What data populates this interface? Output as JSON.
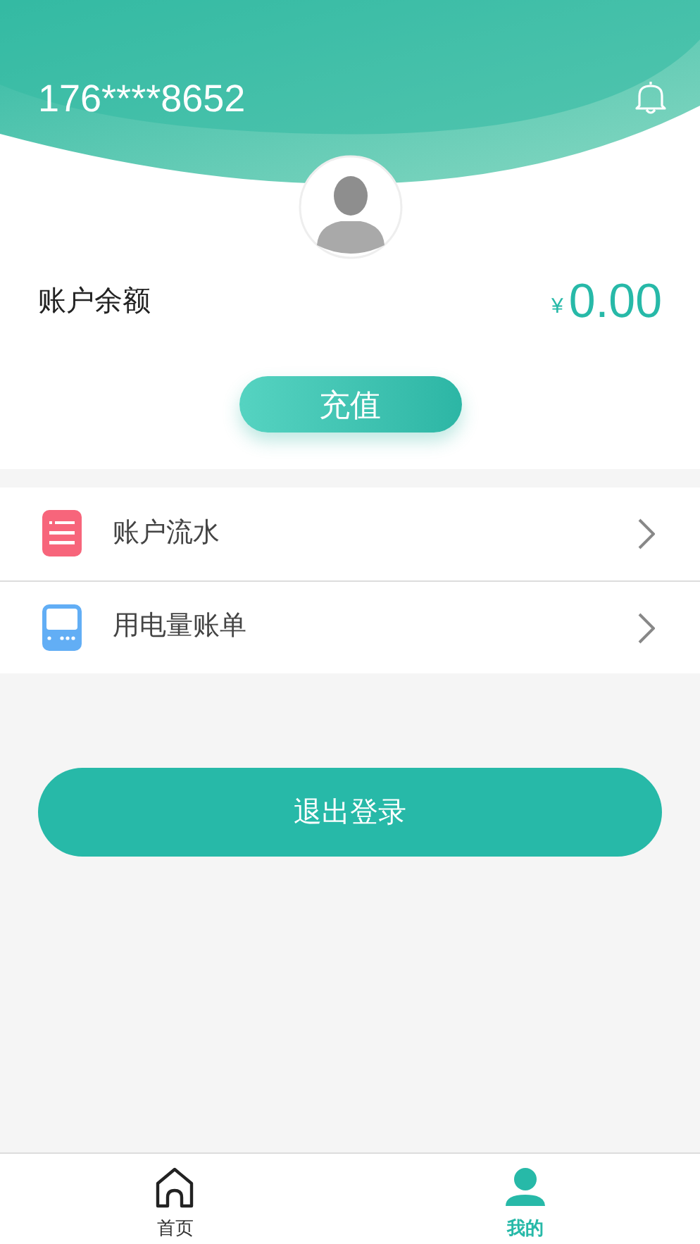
{
  "header": {
    "phone": "176****8652"
  },
  "balance": {
    "label": "账户余额",
    "currency": "¥",
    "amount": "0.00"
  },
  "recharge_button": "充值",
  "menu": [
    {
      "kind": "list",
      "label": "账户流水",
      "color": "#f7657b"
    },
    {
      "kind": "meter",
      "label": "用电量账单",
      "color": "#62aef5"
    }
  ],
  "logout_button": "退出登录",
  "tabs": [
    {
      "kind": "home",
      "label": "首页",
      "selected": false
    },
    {
      "kind": "profile",
      "label": "我的",
      "selected": true
    }
  ]
}
